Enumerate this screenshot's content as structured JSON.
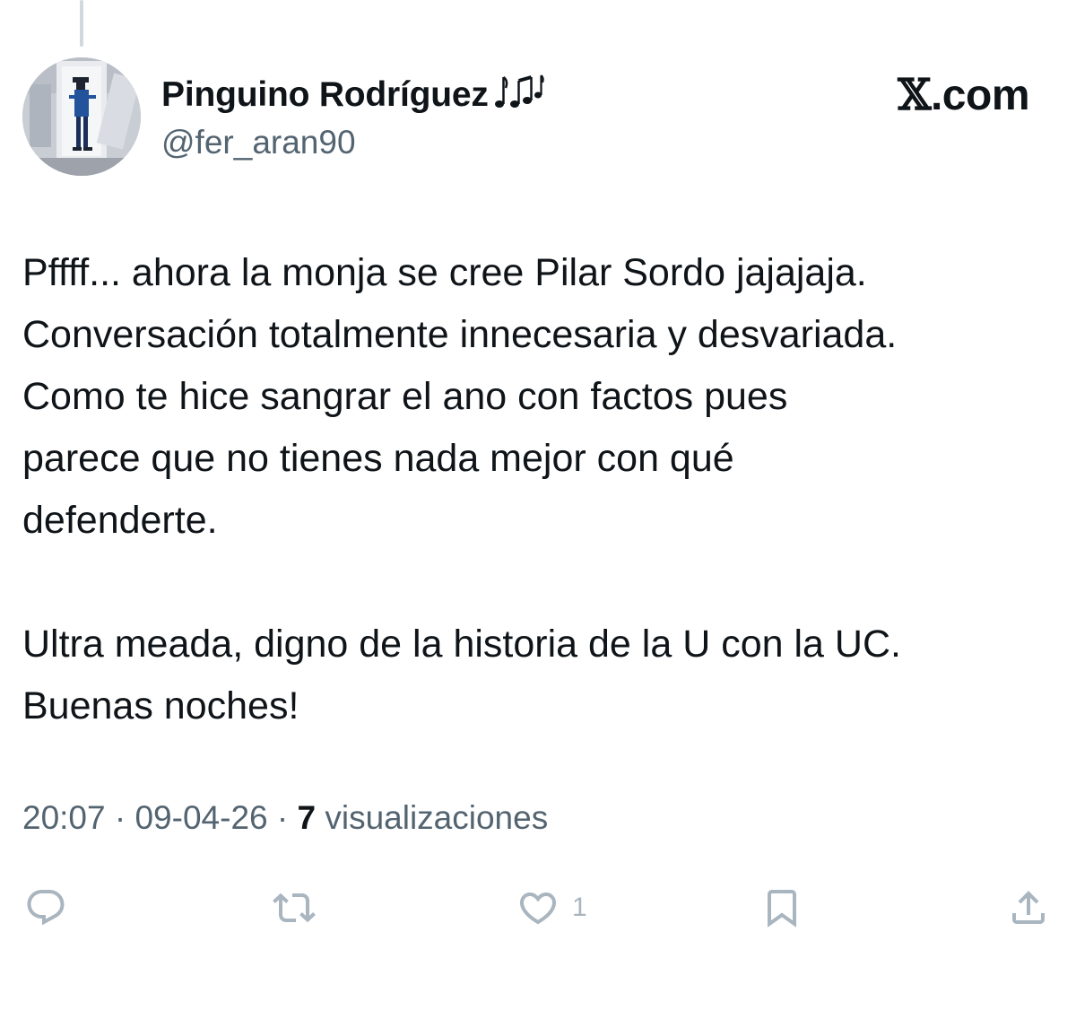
{
  "author": {
    "display_name": "Pinguino Rodríguez",
    "name_emoji": "musical-notes-emoji",
    "handle": "@fer_aran90",
    "avatar_icon": "avatar-pixel-figure"
  },
  "brand": {
    "x_glyph": "𝕏",
    "domain": ".com"
  },
  "tweet": {
    "paragraphs": [
      "Pffff... ahora la monja se cree Pilar Sordo jajajaja.\nConversación totalmente innecesaria y desvariada.\nComo te hice sangrar el ano con factos pues\nparece que no tienes nada mejor con qué\ndefenderte.",
      "Ultra meada, digno de la historia de la U con la UC.\nBuenas noches!"
    ]
  },
  "meta": {
    "time": "20:07",
    "separator": " · ",
    "date": "09-04-26",
    "views_count": "7",
    "views_label": " visualizaciones"
  },
  "actions": {
    "reply_icon": "reply-icon",
    "retweet_icon": "retweet-icon",
    "like_icon": "heart-icon",
    "like_count": "1",
    "bookmark_icon": "bookmark-icon",
    "share_icon": "share-icon"
  },
  "colors": {
    "text_primary": "#0f1419",
    "text_secondary": "#536471",
    "icon_muted": "#a9b5bf",
    "thread_line": "#cfd9de"
  }
}
